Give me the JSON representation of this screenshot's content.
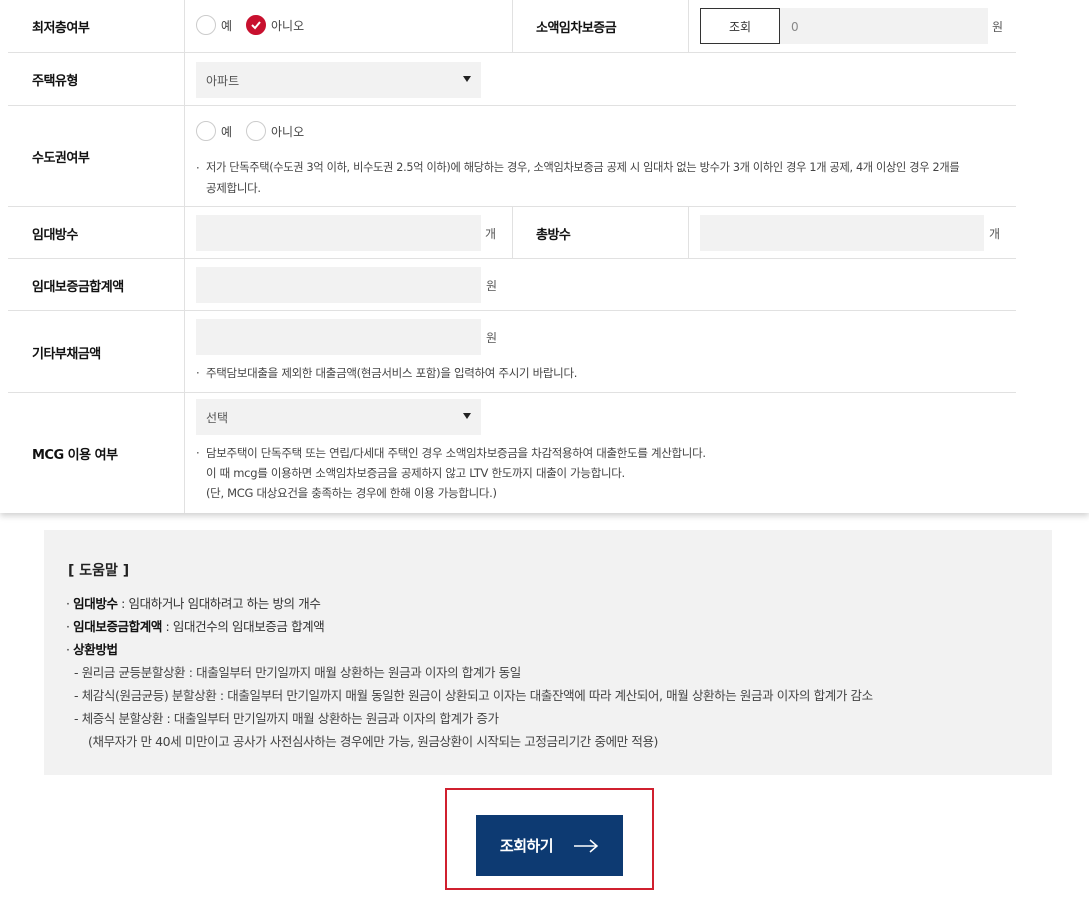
{
  "form": {
    "rows": {
      "lowest_floor": {
        "label": "최저층여부",
        "options": [
          "예",
          "아니오"
        ],
        "selected": "아니오"
      },
      "small_deposit": {
        "label": "소액임차보증금",
        "lookup_label": "조회",
        "value": "0",
        "unit": "원"
      },
      "house_type": {
        "label": "주택유형",
        "selected": "아파트"
      },
      "capital_area": {
        "label": "수도권여부",
        "options": [
          "예",
          "아니오"
        ],
        "note_line1": "저가 단독주택(수도권 3억 이하, 비수도권 2.5억 이하)에 해당하는 경우, 소액임차보증금 공제 시 임대차 없는 방수가 3개 이하인 경우 1개 공제, 4개 이상인 경우 2개를",
        "note_line2": "공제합니다."
      },
      "rented_rooms": {
        "label": "임대방수",
        "unit": "개"
      },
      "total_rooms": {
        "label": "총방수",
        "unit": "개"
      },
      "deposit_total": {
        "label": "임대보증금합계액",
        "unit": "원"
      },
      "other_debt": {
        "label": "기타부채금액",
        "unit": "원",
        "note": "주택담보대출을 제외한 대출금액(현금서비스 포함)을 입력하여 주시기 바랍니다."
      },
      "mcg": {
        "label": "MCG 이용 여부",
        "selected": "선택",
        "note_line1": "담보주택이 단독주택 또는 연립/다세대 주택인 경우 소액임차보증금을 차감적용하여 대출한도를 계산합니다.",
        "note_line2": "이 때 mcg를 이용하면 소액임차보증금을 공제하지 않고 LTV 한도까지 대출이 가능합니다.",
        "note_line3": "(단, MCG 대상요건을 충족하는 경우에 한해 이용 가능합니다.)"
      }
    }
  },
  "help": {
    "title": "[ 도움말 ]",
    "items": [
      {
        "term": "임대방수",
        "desc": " : 임대하거나 임대하려고 하는 방의 개수"
      },
      {
        "term": "임대보증금합계액",
        "desc": " : 임대건수의 임대보증금 합계액"
      },
      {
        "term": "상환방법",
        "desc": ""
      }
    ],
    "sub_items": [
      "원리금 균등분할상환 : 대출일부터 만기일까지 매월 상환하는 원금과 이자의 합계가 동일",
      "체감식(원금균등) 분할상환 : 대출일부터 만기일까지 매월 동일한 원금이 상환되고 이자는 대출잔액에 따라 계산되어, 매월 상환하는 원금과 이자의 합계가 감소",
      "체증식 분할상환 : 대출일부터 만기일까지 매월 상환하는 원금과 이자의 합계가 증가",
      "(채무자가 만 40세 미만이고 공사가 사전심사하는 경우에만 가능, 원금상환이 시작되는 고정금리기간 중에만 적용)"
    ]
  },
  "submit": {
    "label": "조회하기"
  },
  "colors": {
    "accent": "#c8102e",
    "button": "#0d3a72",
    "highlight": "#d0202f"
  }
}
